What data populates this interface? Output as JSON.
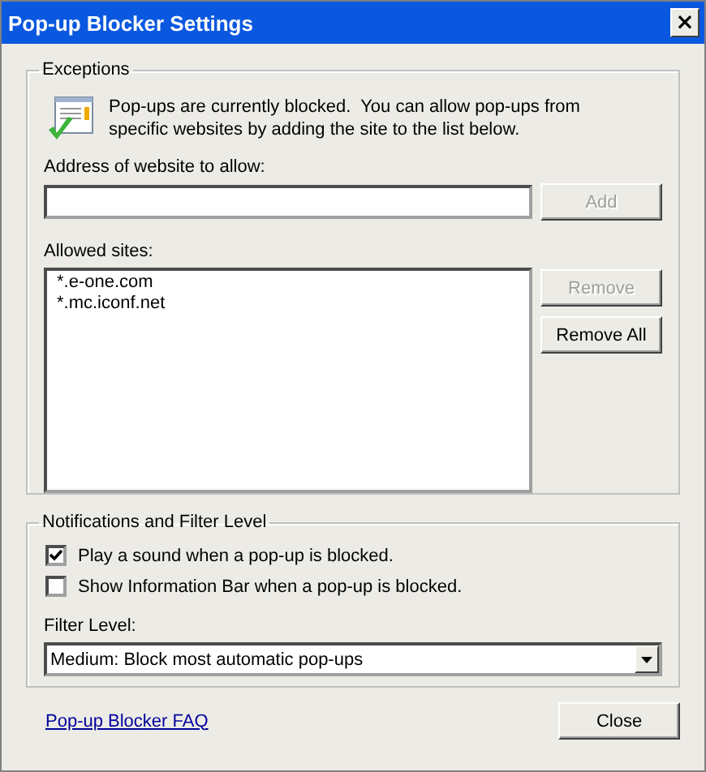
{
  "window": {
    "title": "Pop-up Blocker Settings",
    "close": "×"
  },
  "exceptions": {
    "title": "Exceptions",
    "message": "Pop-ups are currently blocked.  You can allow pop-ups from specific websites by adding the site to the list below.",
    "address_label": "Address of website to allow:",
    "add_button": {
      "label": "Add",
      "disabled": true
    },
    "sites_label": "Allowed sites:",
    "sites": [
      "*.e-one.com",
      "*.mc.iconf.net"
    ],
    "remove_button": {
      "label": "Remove",
      "disabled": true
    },
    "remove_all_button": {
      "label": "Remove All",
      "disabled": false
    }
  },
  "notifications": {
    "title": "Notifications and Filter Level",
    "options": [
      {
        "label": "Play a sound when a pop-up is blocked.",
        "checked": true
      },
      {
        "label": "Show Information Bar when a pop-up is blocked.",
        "checked": false
      }
    ],
    "filter_label": "Filter Level:",
    "filter_value": "Medium: Block most automatic pop-ups"
  },
  "footer": {
    "link": "Pop-up Blocker FAQ",
    "close_button": "Close"
  }
}
